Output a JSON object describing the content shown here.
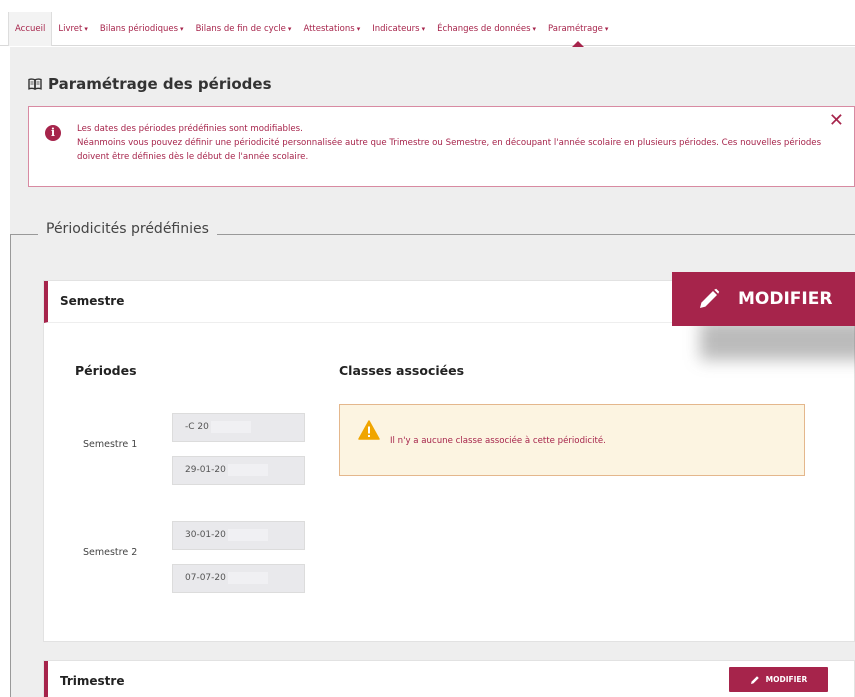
{
  "nav": {
    "items": [
      {
        "label": "Accueil",
        "caret": ""
      },
      {
        "label": "Livret",
        "caret": "▾"
      },
      {
        "label": "Bilans périodiques",
        "caret": "▾"
      },
      {
        "label": "Bilans de fin de cycle",
        "caret": "▾"
      },
      {
        "label": "Attestations",
        "caret": "▾"
      },
      {
        "label": "Indicateurs",
        "caret": "▾"
      },
      {
        "label": "Échanges de données",
        "caret": "▾"
      },
      {
        "label": "Paramétrage",
        "caret": "▾"
      }
    ],
    "active_index": 0
  },
  "page": {
    "title": "Paramétrage des périodes"
  },
  "alert": {
    "line1": "Les dates des périodes prédéfinies sont modifiables.",
    "line2": "Néanmoins vous pouvez définir une périodicité personnalisée autre que Trimestre ou Semestre, en découpant l'année scolaire en plusieurs périodes. Ces nouvelles périodes doivent être définies dès le début de l'année scolaire.",
    "close": "✕"
  },
  "section": {
    "legend": "Périodicités prédéfinies"
  },
  "semestre": {
    "title": "Semestre",
    "periods_heading": "Périodes",
    "classes_heading": "Classes associées",
    "periods": [
      {
        "label": "Semestre 1",
        "start": "-C   20",
        "end": "29-01-20"
      },
      {
        "label": "Semestre 2",
        "start": "30-01-20",
        "end": "07-07-20"
      }
    ],
    "warning": "Il n'y a aucune classe associée à cette périodicité."
  },
  "trimestre": {
    "title": "Trimestre",
    "modify_label": "MODIFIER"
  },
  "zoom_button": {
    "label": "MODIFIER"
  },
  "colors": {
    "accent": "#a6244b",
    "background": "#eeeeee",
    "warning_bg": "#fcf4e1",
    "warning_icon": "#f0a500"
  }
}
